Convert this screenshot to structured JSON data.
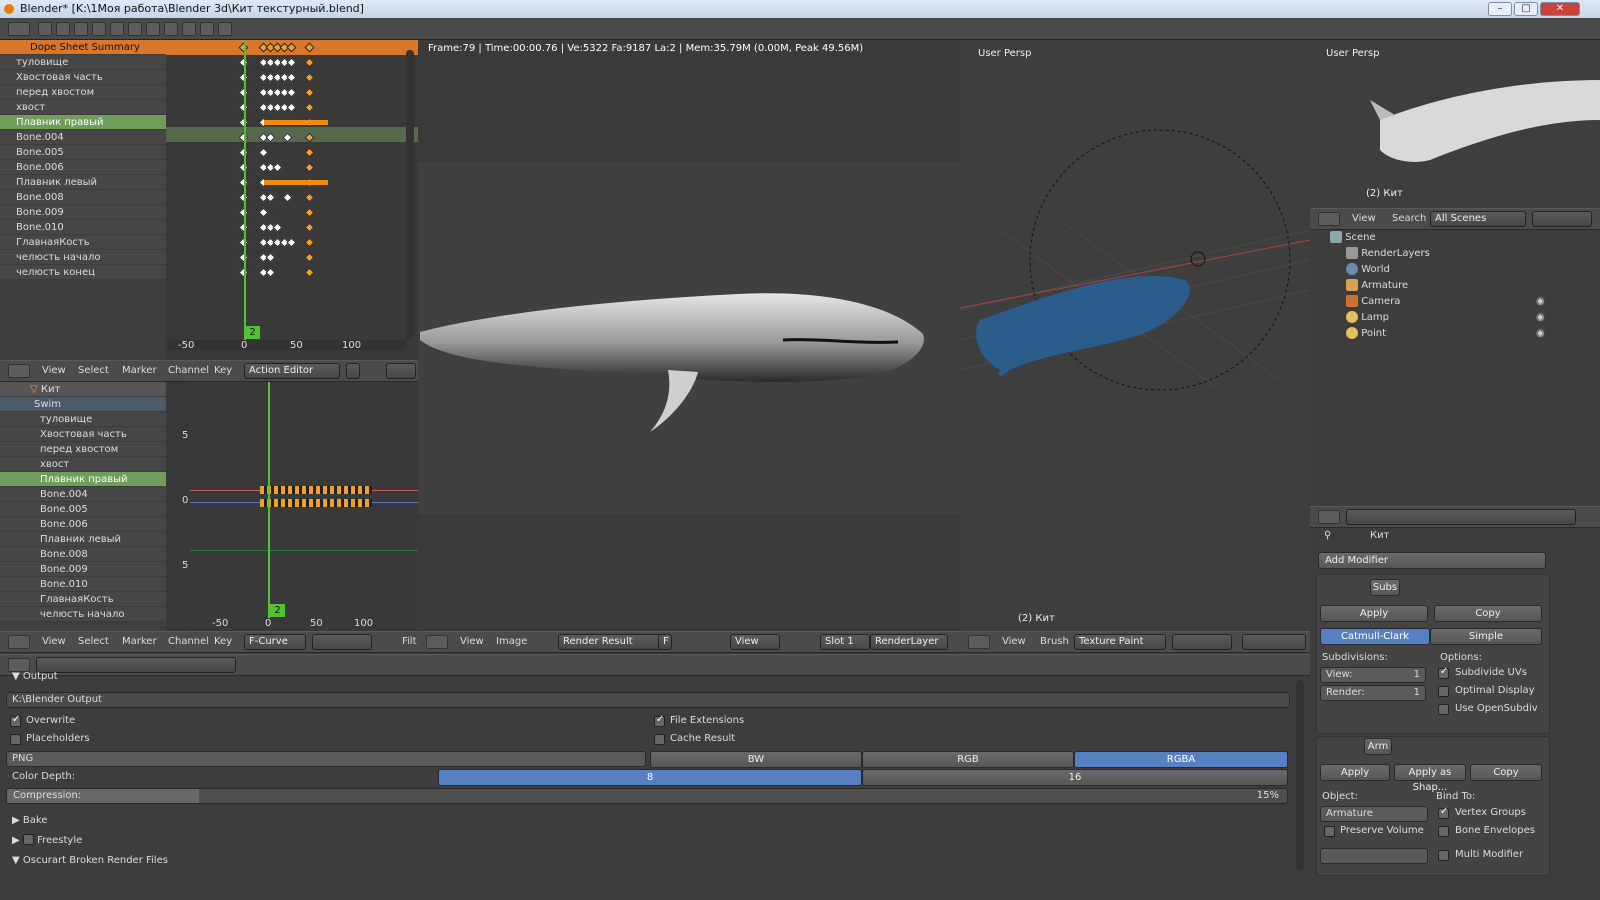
{
  "window": {
    "title": "Blender* [K:\\1Моя работа\\Blender 3d\\Кит текстурный.blend]"
  },
  "dopesheet": {
    "summary": "Dope Sheet Summary",
    "channels": [
      "туловище",
      "Хвостовая часть",
      "перед хвостом",
      "хвост",
      "Плавник правый",
      "Bone.004",
      "Bone.005",
      "Bone.006",
      "Плавник левый",
      "Bone.008",
      "Bone.009",
      "Bone.010",
      "ГлавнаяКость",
      "челюсть начало",
      "челюсть конец"
    ],
    "ticks": [
      "-50",
      "0",
      "50",
      "100"
    ],
    "current_frame": "2",
    "menus": [
      "View",
      "Select",
      "Marker",
      "Channel",
      "Key"
    ],
    "mode": "Action Editor"
  },
  "graph": {
    "object": "Кит",
    "action": "Swim",
    "channels": [
      "туловище",
      "Хвостовая часть",
      "перед хвостом",
      "хвост",
      "Плавник правый",
      "Bone.004",
      "Bone.005",
      "Bone.006",
      "Плавник левый",
      "Bone.008",
      "Bone.009",
      "Bone.010",
      "ГлавнаяКость",
      "челюсть начало"
    ],
    "ticks": [
      "-50",
      "0",
      "50",
      "100"
    ],
    "yticks": [
      "5",
      "0",
      "5"
    ],
    "current_frame": "2",
    "menus": [
      "View",
      "Select",
      "Marker",
      "Channel",
      "Key"
    ],
    "mode": "F-Curve",
    "filter": "Filt"
  },
  "render": {
    "stats": "Frame:79 | Time:00:00.76 | Ve:5322 Fa:9187 La:2 | Mem:35.79M (0.00M, Peak 49.56M)",
    "menus": [
      "View",
      "Image"
    ],
    "result": "Render Result",
    "f": "F",
    "view": "View",
    "slot": "Slot 1",
    "layer": "RenderLayer"
  },
  "viewport": {
    "label": "User Persp",
    "object_label": "(2) Кит",
    "menus": [
      "View",
      "Brush"
    ],
    "mode": "Texture Paint"
  },
  "mini_viewport": {
    "label": "User Persp",
    "object_label": "(2) Кит"
  },
  "outliner": {
    "menus": [
      "View",
      "Search"
    ],
    "scope": "All Scenes",
    "items": [
      "Scene",
      "RenderLayers",
      "World",
      "Armature",
      "Camera",
      "Lamp",
      "Point"
    ]
  },
  "properties": {
    "object": "Кит",
    "add_modifier": "Add Modifier",
    "subsurf": {
      "name": "Subs",
      "apply": "Apply",
      "copy": "Copy",
      "catmull": "Catmull-Clark",
      "simple": "Simple",
      "subdivisions": "Subdivisions:",
      "view_label": "View:",
      "view_value": "1",
      "render_label": "Render:",
      "render_value": "1",
      "options": "Options:",
      "subdivide_uvs": "Subdivide UVs",
      "optimal_display": "Optimal Display",
      "use_opensubdiv": "Use OpenSubdiv"
    },
    "armature": {
      "name": "Arm",
      "apply": "Apply",
      "apply_shape": "Apply as Shap...",
      "copy": "Copy",
      "object_label": "Object:",
      "object_value": "Armature",
      "bind_to": "Bind To:",
      "vertex_groups": "Vertex Groups",
      "bone_envelopes": "Bone Envelopes",
      "preserve_volume": "Preserve Volume",
      "multi_modifier": "Multi Modifier"
    }
  },
  "output": {
    "section": "Output",
    "path": "K:\\Blender Output",
    "overwrite": "Overwrite",
    "file_extensions": "File Extensions",
    "placeholders": "Placeholders",
    "cache_result": "Cache Result",
    "format": "PNG",
    "bw": "BW",
    "rgb": "RGB",
    "rgba": "RGBA",
    "color_depth": "Color Depth:",
    "depth8": "8",
    "depth16": "16",
    "compression": "Compression:",
    "compression_value": "15%",
    "compression_fraction": 0.15,
    "bake": "Bake",
    "freestyle": "Freestyle",
    "oscurart": "Oscurart Broken Render Files"
  }
}
